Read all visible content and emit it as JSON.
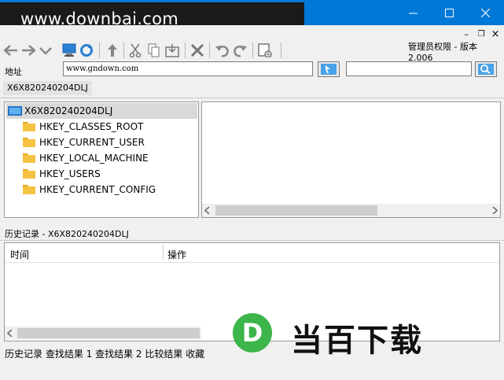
{
  "titlebar": {
    "watermark": "www.downbai.com",
    "minimize_glyph": "─",
    "maximize_glyph": "☐",
    "close_glyph": "✕"
  },
  "toolbar": {
    "admin_version": "管理员权限 - 版本 2.006",
    "icons": [
      "back-icon",
      "forward-icon",
      "dropdown-icon",
      "computer-icon",
      "refresh-icon",
      "up-icon",
      "cut-icon",
      "copy-icon",
      "import-icon",
      "delete-icon",
      "undo-icon",
      "redo-icon",
      "new-key-icon"
    ]
  },
  "mdi_controls": {
    "minimize": "–",
    "restore": "❐",
    "close": "×"
  },
  "address": {
    "label": "地址",
    "value": "www.gndown.com"
  },
  "breadcrumb": "X6X820240204DLJ",
  "tree": {
    "root": "X6X820240204DLJ",
    "items": [
      "HKEY_CLASSES_ROOT",
      "HKEY_CURRENT_USER",
      "HKEY_LOCAL_MACHINE",
      "HKEY_USERS",
      "HKEY_CURRENT_CONFIG"
    ]
  },
  "history": {
    "title": "历史记录 - X6X820240204DLJ",
    "columns": [
      "时间",
      "操作"
    ]
  },
  "bottom_tabs": "历史记录 查找结果 1 查找结果 2 比较结果  收藏",
  "brand": {
    "logo_letter": "D",
    "text": "当百下载"
  },
  "colors": {
    "titlebar": "#0078d7",
    "brand_green": "#3cb54a",
    "selection": "#d9d9d9",
    "folder": "#f5c242"
  }
}
